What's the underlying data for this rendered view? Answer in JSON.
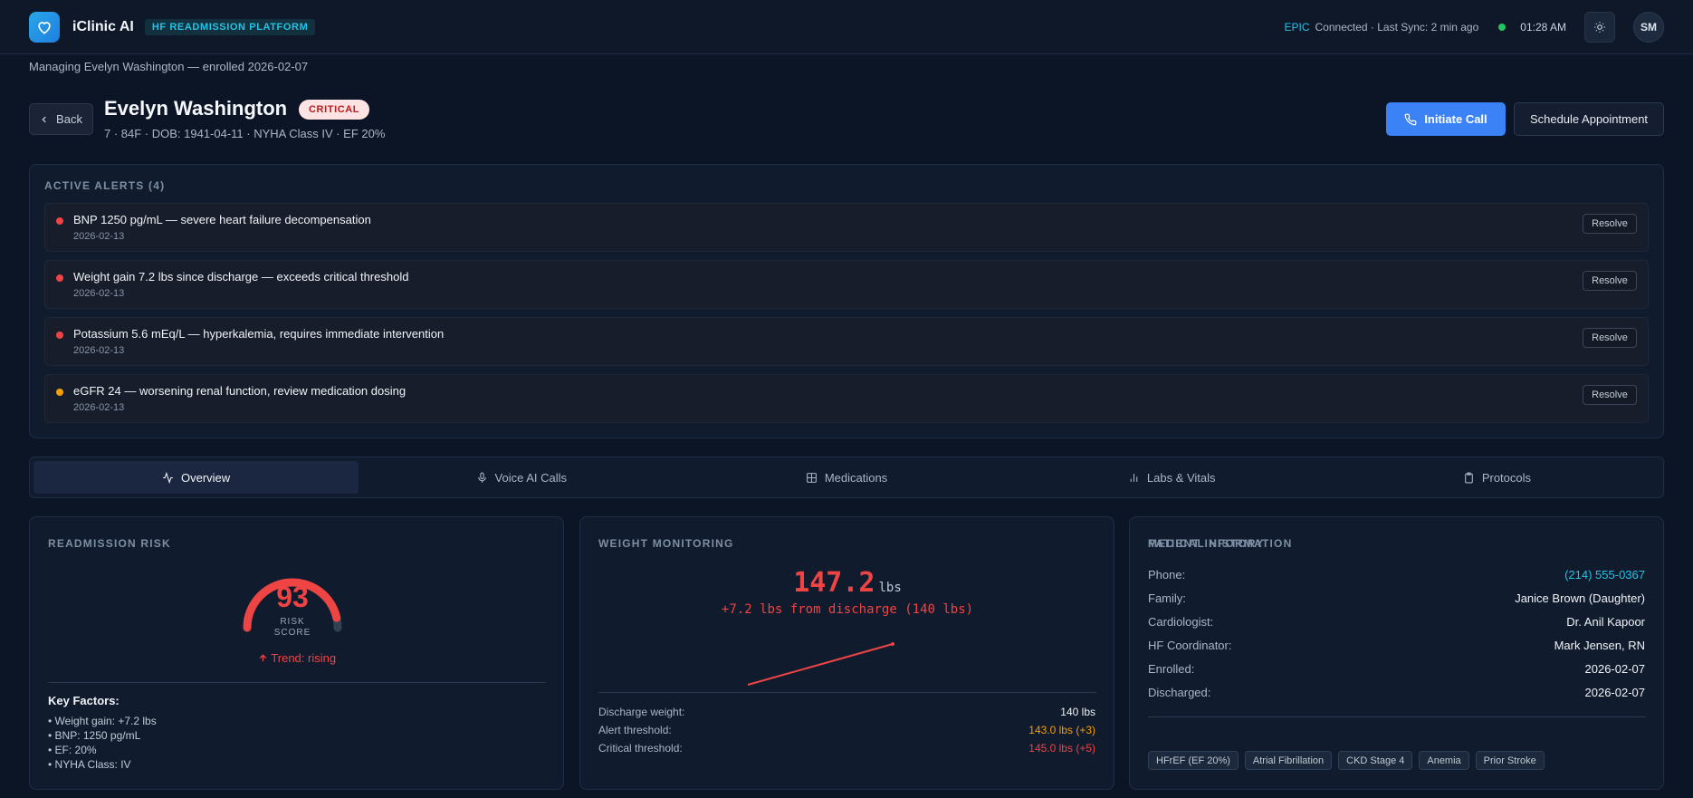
{
  "app": {
    "name": "iClinic AI",
    "platform_badge": "HF READMISSION PLATFORM",
    "ehr": "EPIC",
    "sync_status": "Connected · Last Sync: 2 min ago",
    "time": "01:28 AM",
    "user_initials": "SM",
    "colors": {
      "accent": "#3b82f6",
      "critical": "#ef4444",
      "warning": "#f59e0b",
      "online": "#22c55e",
      "cyan": "#22c3e6"
    }
  },
  "context": {
    "managing_text": "Managing Evelyn Washington — enrolled 2026-02-07"
  },
  "patient": {
    "back_label": "Back",
    "name": "Evelyn Washington",
    "status_badge": "CRITICAL",
    "meta": "7 · 84F · DOB: 1941-04-11 · NYHA Class IV · EF 20%",
    "initiate_call_label": "Initiate Call",
    "schedule_label": "Schedule Appointment"
  },
  "alerts": {
    "title": "ACTIVE ALERTS (4)",
    "resolve_label": "Resolve",
    "items": [
      {
        "text": "BNP 1250 pg/mL — severe heart failure decompensation",
        "date": "2026-02-13",
        "severity": "critical"
      },
      {
        "text": "Weight gain 7.2 lbs since discharge — exceeds critical threshold",
        "date": "2026-02-13",
        "severity": "critical"
      },
      {
        "text": "Potassium 5.6 mEq/L — hyperkalemia, requires immediate intervention",
        "date": "2026-02-13",
        "severity": "critical"
      },
      {
        "text": "eGFR 24 — worsening renal function, review medication dosing",
        "date": "2026-02-13",
        "severity": "warning"
      }
    ]
  },
  "tabs": [
    {
      "label": "Overview",
      "icon": "activity-icon",
      "active": true
    },
    {
      "label": "Voice AI Calls",
      "icon": "mic-icon",
      "active": false
    },
    {
      "label": "Medications",
      "icon": "grid-icon",
      "active": false
    },
    {
      "label": "Labs & Vitals",
      "icon": "bar-chart-icon",
      "active": false
    },
    {
      "label": "Protocols",
      "icon": "clipboard-icon",
      "active": false
    }
  ],
  "risk": {
    "title": "READMISSION RISK",
    "score": "93",
    "score_value": 93,
    "score_label_1": "RISK",
    "score_label_2": "SCORE",
    "trend": "Trend: rising",
    "key_factors_title": "Key Factors:",
    "factors": [
      "• Weight gain: +7.2 lbs",
      "• BNP: 1250 pg/mL",
      "• EF: 20%",
      "• NYHA Class: IV"
    ]
  },
  "weight": {
    "title": "WEIGHT MONITORING",
    "current": "147.2",
    "unit": "lbs",
    "delta_text": "+7.2 lbs from discharge (140 lbs)",
    "rows": [
      {
        "label": "Discharge weight:",
        "value": "140 lbs",
        "tone": "normal"
      },
      {
        "label": "Alert threshold:",
        "value": "143.0 lbs (+3)",
        "tone": "warning"
      },
      {
        "label": "Critical threshold:",
        "value": "145.0 lbs (+5)",
        "tone": "critical"
      }
    ]
  },
  "info": {
    "title": "PATIENT INFORMATION",
    "rows": [
      {
        "label": "Phone:",
        "value": "(214) 555-0367",
        "link": true
      },
      {
        "label": "Family:",
        "value": "Janice Brown (Daughter)"
      },
      {
        "label": "Cardiologist:",
        "value": "Dr. Anil Kapoor"
      },
      {
        "label": "HF Coordinator:",
        "value": "Mark Jensen, RN"
      },
      {
        "label": "Enrolled:",
        "value": "2026-02-07"
      },
      {
        "label": "Discharged:",
        "value": "2026-02-07"
      }
    ],
    "medical_history_title": "MEDICAL HISTORY",
    "medical_history": [
      "HFrEF (EF 20%)",
      "Atrial Fibrillation",
      "CKD Stage 4",
      "Anemia",
      "Prior Stroke"
    ]
  }
}
